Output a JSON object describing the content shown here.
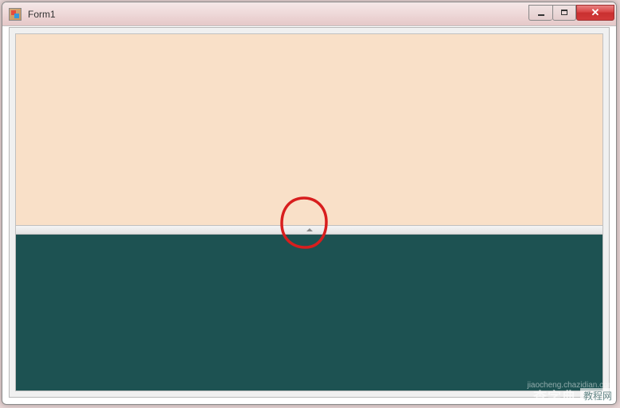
{
  "window": {
    "title": "Form1"
  },
  "panels": {
    "top_color": "#f9e0c8",
    "bottom_color": "#1d5252"
  },
  "annotation": {
    "circle_color": "#d81e1e"
  },
  "watermark": {
    "main": "查字典",
    "sub": "教程网",
    "url": "jiaocheng.chazidian.com"
  }
}
